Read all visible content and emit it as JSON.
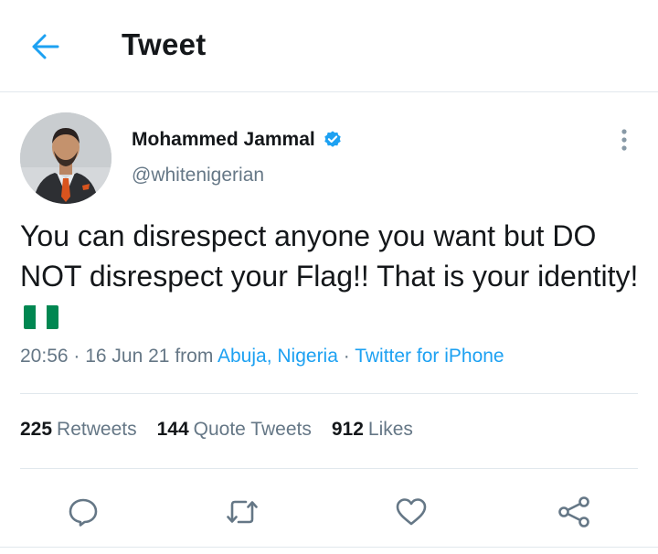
{
  "header": {
    "title": "Tweet",
    "back_icon": "arrow-left-icon",
    "accent": "#1da1f2"
  },
  "tweet": {
    "author": {
      "name": "Mohammed Jammal",
      "handle": "@whitenigerian",
      "verified": true,
      "verified_icon": "verified-badge-icon"
    },
    "text": "You can disrespect anyone you want but DO NOT disrespect your Flag!! That is your identity!",
    "emoji": "nigeria-flag",
    "meta": {
      "time": "20:56",
      "sep1": " · ",
      "date": "16 Jun 21",
      "from_label": " from ",
      "location": "Abuja, Nigeria",
      "sep2": " · ",
      "source": "Twitter for iPhone"
    },
    "stats": {
      "retweets_count": "225",
      "retweets_label": "Retweets",
      "quotes_count": "144",
      "quotes_label": "Quote Tweets",
      "likes_count": "912",
      "likes_label": "Likes"
    },
    "actions": [
      "reply-icon",
      "retweet-icon",
      "like-icon",
      "share-icon"
    ]
  },
  "colors": {
    "text_primary": "#14171a",
    "text_secondary": "#657786",
    "link": "#1da1f2",
    "divider": "#e1e8ed",
    "flag_green": "#008751",
    "flag_white": "#ffffff"
  }
}
